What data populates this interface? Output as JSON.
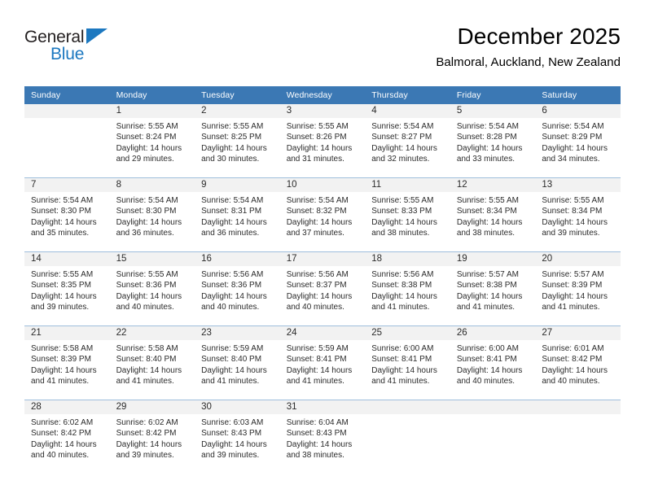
{
  "brand": {
    "name_top": "General",
    "name_bottom": "Blue",
    "accent_color": "#1c78c0",
    "triangle_icon": "brand-triangle-icon"
  },
  "header": {
    "title": "December 2025",
    "subtitle": "Balmoral, Auckland, New Zealand"
  },
  "calendar": {
    "header_bg": "#3b78b4",
    "daynum_bg": "#f2f2f2",
    "separator_color": "#9fbedc",
    "weekday_headers": [
      "Sunday",
      "Monday",
      "Tuesday",
      "Wednesday",
      "Thursday",
      "Friday",
      "Saturday"
    ],
    "weeks": [
      [
        {
          "day": "",
          "lines": []
        },
        {
          "day": "1",
          "lines": [
            "Sunrise: 5:55 AM",
            "Sunset: 8:24 PM",
            "Daylight: 14 hours",
            "and 29 minutes."
          ]
        },
        {
          "day": "2",
          "lines": [
            "Sunrise: 5:55 AM",
            "Sunset: 8:25 PM",
            "Daylight: 14 hours",
            "and 30 minutes."
          ]
        },
        {
          "day": "3",
          "lines": [
            "Sunrise: 5:55 AM",
            "Sunset: 8:26 PM",
            "Daylight: 14 hours",
            "and 31 minutes."
          ]
        },
        {
          "day": "4",
          "lines": [
            "Sunrise: 5:54 AM",
            "Sunset: 8:27 PM",
            "Daylight: 14 hours",
            "and 32 minutes."
          ]
        },
        {
          "day": "5",
          "lines": [
            "Sunrise: 5:54 AM",
            "Sunset: 8:28 PM",
            "Daylight: 14 hours",
            "and 33 minutes."
          ]
        },
        {
          "day": "6",
          "lines": [
            "Sunrise: 5:54 AM",
            "Sunset: 8:29 PM",
            "Daylight: 14 hours",
            "and 34 minutes."
          ]
        }
      ],
      [
        {
          "day": "7",
          "lines": [
            "Sunrise: 5:54 AM",
            "Sunset: 8:30 PM",
            "Daylight: 14 hours",
            "and 35 minutes."
          ]
        },
        {
          "day": "8",
          "lines": [
            "Sunrise: 5:54 AM",
            "Sunset: 8:30 PM",
            "Daylight: 14 hours",
            "and 36 minutes."
          ]
        },
        {
          "day": "9",
          "lines": [
            "Sunrise: 5:54 AM",
            "Sunset: 8:31 PM",
            "Daylight: 14 hours",
            "and 36 minutes."
          ]
        },
        {
          "day": "10",
          "lines": [
            "Sunrise: 5:54 AM",
            "Sunset: 8:32 PM",
            "Daylight: 14 hours",
            "and 37 minutes."
          ]
        },
        {
          "day": "11",
          "lines": [
            "Sunrise: 5:55 AM",
            "Sunset: 8:33 PM",
            "Daylight: 14 hours",
            "and 38 minutes."
          ]
        },
        {
          "day": "12",
          "lines": [
            "Sunrise: 5:55 AM",
            "Sunset: 8:34 PM",
            "Daylight: 14 hours",
            "and 38 minutes."
          ]
        },
        {
          "day": "13",
          "lines": [
            "Sunrise: 5:55 AM",
            "Sunset: 8:34 PM",
            "Daylight: 14 hours",
            "and 39 minutes."
          ]
        }
      ],
      [
        {
          "day": "14",
          "lines": [
            "Sunrise: 5:55 AM",
            "Sunset: 8:35 PM",
            "Daylight: 14 hours",
            "and 39 minutes."
          ]
        },
        {
          "day": "15",
          "lines": [
            "Sunrise: 5:55 AM",
            "Sunset: 8:36 PM",
            "Daylight: 14 hours",
            "and 40 minutes."
          ]
        },
        {
          "day": "16",
          "lines": [
            "Sunrise: 5:56 AM",
            "Sunset: 8:36 PM",
            "Daylight: 14 hours",
            "and 40 minutes."
          ]
        },
        {
          "day": "17",
          "lines": [
            "Sunrise: 5:56 AM",
            "Sunset: 8:37 PM",
            "Daylight: 14 hours",
            "and 40 minutes."
          ]
        },
        {
          "day": "18",
          "lines": [
            "Sunrise: 5:56 AM",
            "Sunset: 8:38 PM",
            "Daylight: 14 hours",
            "and 41 minutes."
          ]
        },
        {
          "day": "19",
          "lines": [
            "Sunrise: 5:57 AM",
            "Sunset: 8:38 PM",
            "Daylight: 14 hours",
            "and 41 minutes."
          ]
        },
        {
          "day": "20",
          "lines": [
            "Sunrise: 5:57 AM",
            "Sunset: 8:39 PM",
            "Daylight: 14 hours",
            "and 41 minutes."
          ]
        }
      ],
      [
        {
          "day": "21",
          "lines": [
            "Sunrise: 5:58 AM",
            "Sunset: 8:39 PM",
            "Daylight: 14 hours",
            "and 41 minutes."
          ]
        },
        {
          "day": "22",
          "lines": [
            "Sunrise: 5:58 AM",
            "Sunset: 8:40 PM",
            "Daylight: 14 hours",
            "and 41 minutes."
          ]
        },
        {
          "day": "23",
          "lines": [
            "Sunrise: 5:59 AM",
            "Sunset: 8:40 PM",
            "Daylight: 14 hours",
            "and 41 minutes."
          ]
        },
        {
          "day": "24",
          "lines": [
            "Sunrise: 5:59 AM",
            "Sunset: 8:41 PM",
            "Daylight: 14 hours",
            "and 41 minutes."
          ]
        },
        {
          "day": "25",
          "lines": [
            "Sunrise: 6:00 AM",
            "Sunset: 8:41 PM",
            "Daylight: 14 hours",
            "and 41 minutes."
          ]
        },
        {
          "day": "26",
          "lines": [
            "Sunrise: 6:00 AM",
            "Sunset: 8:41 PM",
            "Daylight: 14 hours",
            "and 40 minutes."
          ]
        },
        {
          "day": "27",
          "lines": [
            "Sunrise: 6:01 AM",
            "Sunset: 8:42 PM",
            "Daylight: 14 hours",
            "and 40 minutes."
          ]
        }
      ],
      [
        {
          "day": "28",
          "lines": [
            "Sunrise: 6:02 AM",
            "Sunset: 8:42 PM",
            "Daylight: 14 hours",
            "and 40 minutes."
          ]
        },
        {
          "day": "29",
          "lines": [
            "Sunrise: 6:02 AM",
            "Sunset: 8:42 PM",
            "Daylight: 14 hours",
            "and 39 minutes."
          ]
        },
        {
          "day": "30",
          "lines": [
            "Sunrise: 6:03 AM",
            "Sunset: 8:43 PM",
            "Daylight: 14 hours",
            "and 39 minutes."
          ]
        },
        {
          "day": "31",
          "lines": [
            "Sunrise: 6:04 AM",
            "Sunset: 8:43 PM",
            "Daylight: 14 hours",
            "and 38 minutes."
          ]
        },
        {
          "day": "",
          "lines": []
        },
        {
          "day": "",
          "lines": []
        },
        {
          "day": "",
          "lines": []
        }
      ]
    ]
  }
}
